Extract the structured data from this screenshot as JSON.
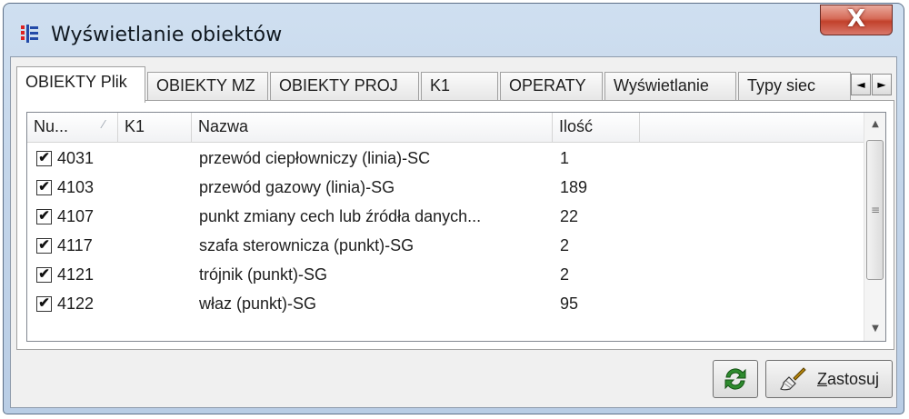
{
  "window": {
    "title": "Wyświetlanie obiektów",
    "close_label": "X"
  },
  "tabs": [
    {
      "label": "OBIEKTY Plik",
      "active": true
    },
    {
      "label": "OBIEKTY MZ",
      "active": false
    },
    {
      "label": "OBIEKTY PROJ",
      "active": false
    },
    {
      "label": "K1",
      "active": false
    },
    {
      "label": "OPERATY",
      "active": false
    },
    {
      "label": "Wyświetlanie",
      "active": false
    },
    {
      "label": "Typy siec",
      "active": false
    }
  ],
  "tab_scroll": {
    "left": "◄",
    "right": "►"
  },
  "grid": {
    "columns": [
      "Nu...",
      "K1",
      "Nazwa",
      "Ilość"
    ],
    "sort_indicator": "⁄",
    "rows": [
      {
        "checked": true,
        "number": "4031",
        "k1": "",
        "name": "przewód ciepłowniczy (linia)-SC",
        "qty": "1"
      },
      {
        "checked": true,
        "number": "4103",
        "k1": "",
        "name": "przewód gazowy (linia)-SG",
        "qty": "189"
      },
      {
        "checked": true,
        "number": "4107",
        "k1": "",
        "name": "punkt zmiany cech lub źródła danych...",
        "qty": "22"
      },
      {
        "checked": true,
        "number": "4117",
        "k1": "",
        "name": "szafa sterownicza (punkt)-SG",
        "qty": "2"
      },
      {
        "checked": true,
        "number": "4121",
        "k1": "",
        "name": "trójnik (punkt)-SG",
        "qty": "2"
      },
      {
        "checked": true,
        "number": "4122",
        "k1": "",
        "name": "właz (punkt)-SG",
        "qty": "95"
      }
    ],
    "check_glyph": "✔",
    "scroll_up": "▲",
    "scroll_down": "▼",
    "scroll_grip": "≡"
  },
  "buttons": {
    "refresh_icon": "refresh-icon",
    "apply_accel": "Z",
    "apply_rest": "astosuj"
  },
  "colors": {
    "refresh_green": "#2e8b2e",
    "close_red": "#c2412b"
  }
}
